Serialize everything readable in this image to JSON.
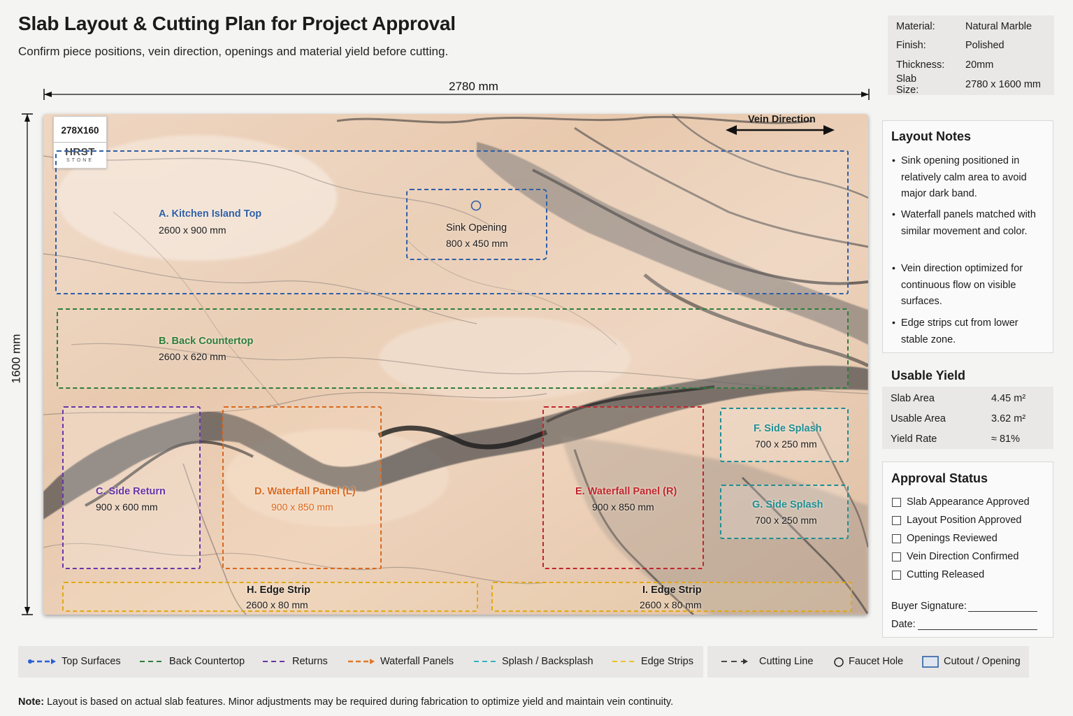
{
  "header": {
    "title": "Slab Layout & Cutting Plan for Project Approval",
    "subtitle": "Confirm piece positions, vein direction, openings and material yield before cutting."
  },
  "specs": [
    {
      "label": "Material:",
      "value": "Natural Marble"
    },
    {
      "label": "Finish:",
      "value": "Polished"
    },
    {
      "label": "Thickness:",
      "value": "20mm"
    },
    {
      "label": "Slab Size:",
      "value": "2780 x 1600 mm"
    }
  ],
  "dimensions": {
    "width_label": "2780 mm",
    "height_label": "1600 mm"
  },
  "badge": {
    "size": "278X160",
    "brand": "HRST",
    "brand_sub": "STONE"
  },
  "vein_direction_label": "Vein Direction",
  "pieces": {
    "a": {
      "title": "A. Kitchen Island Top",
      "dim": "2600 x 900 mm",
      "color": "#2f5fa6"
    },
    "sink": {
      "title": "Sink Opening",
      "dim": "800 x 450 mm",
      "color": "#2f5fa6"
    },
    "b": {
      "title": "B. Back Countertop",
      "dim": "2600 x 620 mm",
      "color": "#2e7d3a"
    },
    "c": {
      "title": "C. Side Return",
      "dim": "900 x 600 mm",
      "color": "#6a35a8"
    },
    "d": {
      "title": "D. Waterfall Panel (L)",
      "dim": "900 x 850 mm",
      "color": "#d9681e"
    },
    "e": {
      "title": "E. Waterfall Panel (R)",
      "dim": "900 x 850 mm",
      "color": "#c0262d"
    },
    "f": {
      "title": "F. Side Splash",
      "dim": "700 x 250 mm",
      "color": "#1f8e93"
    },
    "g": {
      "title": "G. Side Splash",
      "dim": "700 x 250 mm",
      "color": "#1f8e93"
    },
    "h": {
      "title": "H. Edge Strip",
      "dim": "2600 x 80 mm",
      "color": "#e0a817"
    },
    "i": {
      "title": "I. Edge Strip",
      "dim": "2600 x 80 mm",
      "color": "#e0a817"
    }
  },
  "layout_notes": {
    "title": "Layout Notes",
    "items": [
      "Sink opening positioned in relatively calm area to avoid major dark band.",
      "Waterfall panels matched with similar movement and color.",
      "Vein direction optimized for continuous flow on visible surfaces.",
      "Edge strips cut from lower stable zone."
    ]
  },
  "usable_yield": {
    "title": "Usable Yield",
    "rows": [
      {
        "label": "Slab Area",
        "value": "4.45 m²"
      },
      {
        "label": "Usable Area",
        "value": "3.62 m²"
      },
      {
        "label": "Yield Rate",
        "value": "≈ 81%"
      }
    ]
  },
  "approval": {
    "title": "Approval Status",
    "items": [
      "Slab Appearance Approved",
      "Layout Position Approved",
      "Openings Reviewed",
      "Vein Direction Confirmed",
      "Cutting Released"
    ],
    "signature_label": "Buyer Signature:",
    "date_label": "Date:"
  },
  "legend": {
    "items": [
      {
        "label": "Top Surfaces",
        "color": "#2a5fd6"
      },
      {
        "label": "Back Countertop",
        "color": "#2e7d3a"
      },
      {
        "label": "Returns",
        "color": "#6a35a8"
      },
      {
        "label": "Waterfall Panels",
        "color": "#e0782a"
      },
      {
        "label": "Splash / Backsplash",
        "color": "#33b5c0"
      },
      {
        "label": "Edge Strips",
        "color": "#f0c020"
      }
    ],
    "symbols": [
      {
        "label": "Cutting Line"
      },
      {
        "label": "Faucet Hole"
      },
      {
        "label": "Cutout / Opening"
      }
    ]
  },
  "footer_note": {
    "prefix": "Note:",
    "text": " Layout is based on actual slab features. Minor adjustments may be required during fabrication to optimize yield and maintain vein continuity."
  }
}
